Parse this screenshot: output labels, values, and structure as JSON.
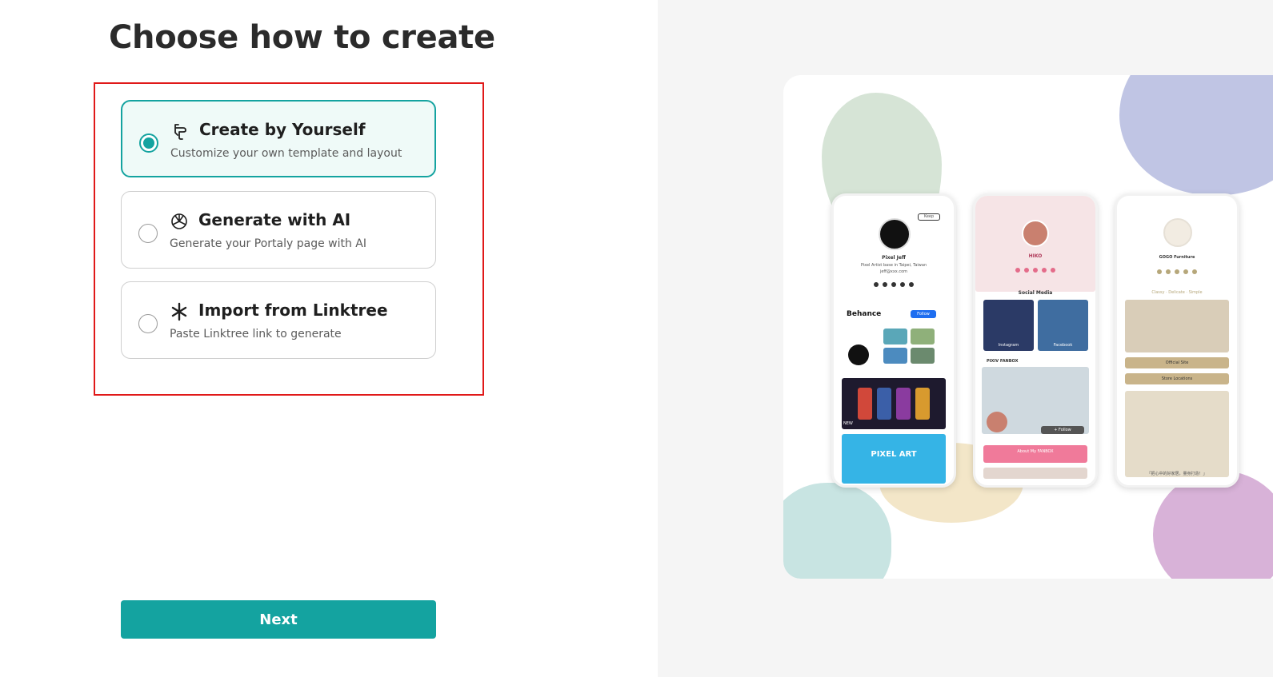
{
  "page": {
    "title": "Choose how to create"
  },
  "options": [
    {
      "title": "Create by Yourself",
      "description": "Customize your own template and layout",
      "icon": "hand-pointer-icon",
      "selected": true
    },
    {
      "title": "Generate with AI",
      "description": "Generate your Portaly page with AI",
      "icon": "ai-knot-icon",
      "selected": false
    },
    {
      "title": "Import from Linktree",
      "description": "Paste Linktree link to generate",
      "icon": "linktree-asterisk-icon",
      "selected": false
    }
  ],
  "actions": {
    "next_label": "Next"
  },
  "preview": {
    "phone1": {
      "name": "Pixel Jeff",
      "bio": "Pixel Artist base in Taipei, Taiwan",
      "email": "jeff@xxx.com",
      "keep": "Keep",
      "behance": "Behance",
      "follow": "Follow",
      "pixel_art": "PIXEL ART",
      "new_tag": "NEW"
    },
    "phone2": {
      "name": "HIKO",
      "section": "Social Media",
      "instagram": "Instagram",
      "facebook": "Facebook",
      "fanbox": "PIXIV FANBOX",
      "follow": "+ Follow",
      "about": "About My FANBOX"
    },
    "phone3": {
      "name": "GOGO Furniture",
      "tagline": "Classy · Delicate · Simple",
      "official": "Official Site",
      "stores": "Store Locations",
      "caption": "「把心中的好家居，量身打造！」"
    }
  },
  "colors": {
    "accent": "#14a3a0",
    "highlight_frame": "#e01919"
  }
}
